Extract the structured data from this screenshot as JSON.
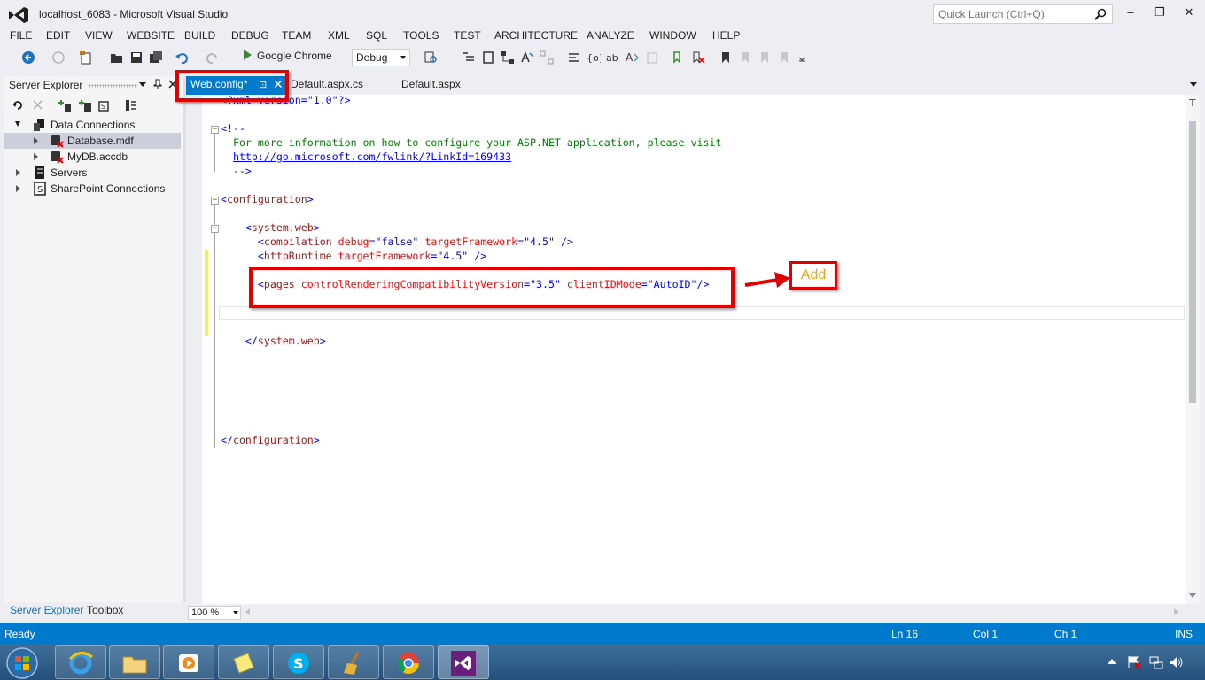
{
  "window": {
    "title": "localhost_6083 - Microsoft Visual Studio"
  },
  "quick_launch": {
    "placeholder": "Quick Launch (Ctrl+Q)"
  },
  "menu": [
    "FILE",
    "EDIT",
    "VIEW",
    "WEBSITE",
    "BUILD",
    "DEBUG",
    "TEAM",
    "XML",
    "SQL",
    "TOOLS",
    "TEST",
    "ARCHITECTURE",
    "ANALYZE",
    "WINDOW",
    "HELP"
  ],
  "toolbar": {
    "run_target": "Google Chrome",
    "configuration": "Debug"
  },
  "server_explorer": {
    "title": "Server Explorer",
    "tree": [
      {
        "label": "Data Connections",
        "expanded": true
      },
      {
        "label": "Database.mdf",
        "selected": true
      },
      {
        "label": "MyDB.accdb"
      },
      {
        "label": "Servers"
      },
      {
        "label": "SharePoint Connections"
      }
    ],
    "bottom_tabs": [
      "Server Explorer",
      "Toolbox"
    ]
  },
  "editor_tabs": [
    {
      "label": "Web.config*",
      "active": true
    },
    {
      "label": "Default.aspx.cs"
    },
    {
      "label": "Default.aspx"
    }
  ],
  "editor": {
    "lines": {
      "xml_decl_prefix": "<?xml version=",
      "xml_decl_value": "\"1.0\"",
      "xml_decl_suffix": "?>",
      "comment_open": "<!--",
      "comment_text": "  For more information on how to configure your ASP.NET application, please visit",
      "comment_link": "http://go.microsoft.com/fwlink/?LinkId=169433",
      "comment_close": "  -->",
      "configuration_open": "configuration",
      "system_web": "system.web",
      "compilation_tag": "compilation",
      "compilation_attr1": "debug",
      "compilation_val1": "\"false\"",
      "compilation_attr2": "targetFramework",
      "compilation_val2": "\"4.5\"",
      "httpruntime_tag": "httpRuntime",
      "httpruntime_attr": "targetFramework",
      "httpruntime_val": "\"4.5\"",
      "pages_tag": "pages",
      "pages_attr1": "controlRenderingCompatibilityVersion",
      "pages_val1": "\"3.5\"",
      "pages_attr2": "clientIDMode",
      "pages_val2": "\"AutoID\"",
      "system_web_close": "system.web",
      "configuration_close": "configuration"
    },
    "zoom": "100 %"
  },
  "annotation": {
    "label": "Add"
  },
  "status": {
    "state": "Ready",
    "line": "Ln 16",
    "col": "Col 1",
    "ch": "Ch 1",
    "mode": "INS"
  },
  "colors": {
    "accent": "#007acc",
    "annotation_red": "#e10000",
    "annotation_text": "#f2a30c"
  }
}
